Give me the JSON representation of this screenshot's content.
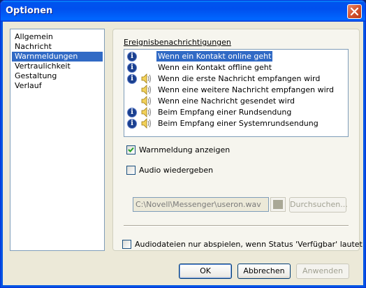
{
  "window": {
    "title": "Optionen"
  },
  "nav": {
    "items": [
      {
        "label": "Allgemein",
        "selected": false
      },
      {
        "label": "Nachricht",
        "selected": false
      },
      {
        "label": "Warnmeldungen",
        "selected": true
      },
      {
        "label": "Vertraulichkeit",
        "selected": false
      },
      {
        "label": "Gestaltung",
        "selected": false
      },
      {
        "label": "Verlauf",
        "selected": false
      }
    ]
  },
  "events": {
    "group_label": "Ereignisbenachrichtigungen",
    "items": [
      {
        "label": "Wenn ein Kontakt online geht",
        "info_icon": true,
        "speaker_icon": false,
        "selected": true
      },
      {
        "label": "Wenn ein Kontakt offline geht",
        "info_icon": true,
        "speaker_icon": false,
        "selected": false
      },
      {
        "label": "Wenn die erste Nachricht empfangen wird",
        "info_icon": true,
        "speaker_icon": true,
        "selected": false
      },
      {
        "label": "Wenn eine weitere Nachricht empfangen wird",
        "info_icon": false,
        "speaker_icon": true,
        "selected": false
      },
      {
        "label": "Wenn eine Nachricht gesendet wird",
        "info_icon": false,
        "speaker_icon": true,
        "selected": false
      },
      {
        "label": "Beim Empfang einer Rundsendung",
        "info_icon": true,
        "speaker_icon": true,
        "selected": false
      },
      {
        "label": "Beim Empfang einer Systemrundsendung",
        "info_icon": true,
        "speaker_icon": true,
        "selected": false
      }
    ]
  },
  "options": {
    "show_alert": {
      "label": "Warnmeldung anzeigen",
      "checked": true
    },
    "play_audio": {
      "label": "Audio wiedergeben",
      "checked": false
    },
    "audio_file": {
      "value": "C:\\Novell\\Messenger\\useron.wav"
    },
    "browse_label": "Durchsuchen...",
    "only_available": {
      "label": "Audiodateien nur abspielen, wenn Status 'Verfügbar' lautet",
      "checked": false
    }
  },
  "buttons": {
    "ok": "OK",
    "cancel": "Abbrechen",
    "apply": "Anwenden"
  },
  "icons": {
    "info": "info-icon",
    "speaker": "speaker-icon",
    "close": "close-icon",
    "check": "check-icon",
    "color_swatch": "color-swatch-icon"
  },
  "colors": {
    "titlebar": "#0054e3",
    "selection": "#316ac5",
    "face": "#ece9d8",
    "close": "#d4532e"
  }
}
